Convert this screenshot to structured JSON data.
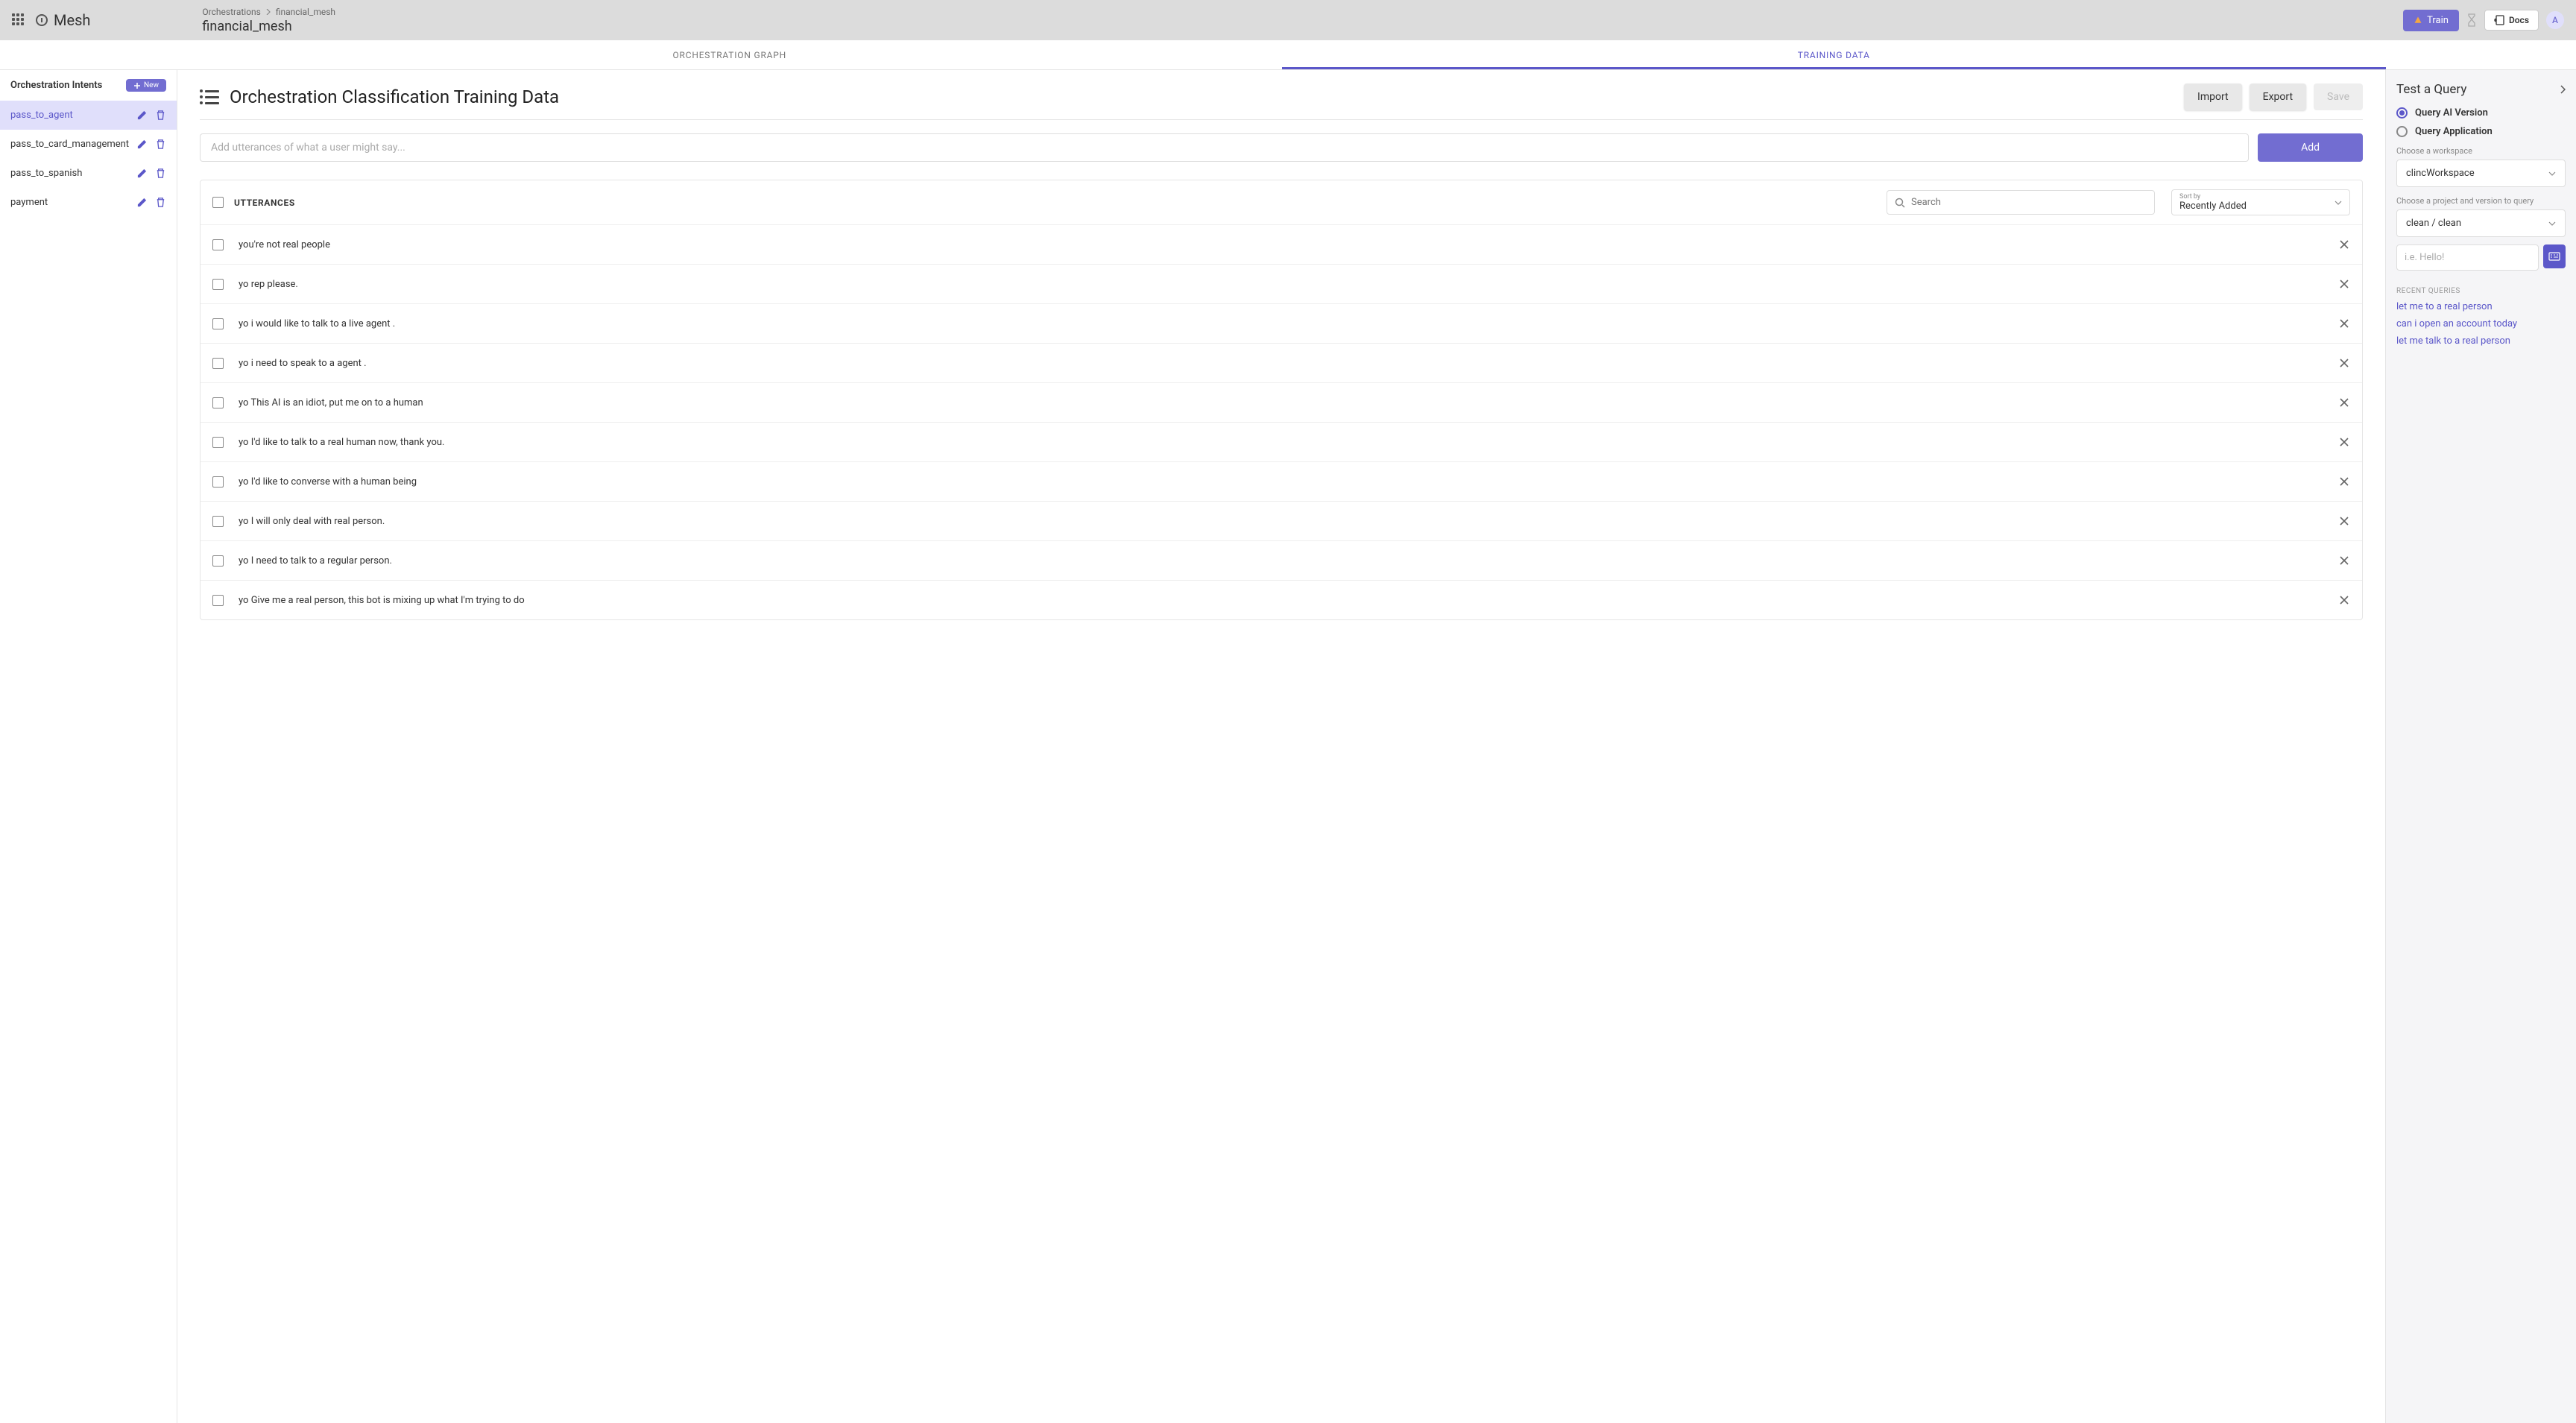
{
  "app": {
    "name": "Mesh"
  },
  "breadcrumb": {
    "root": "Orchestrations",
    "current": "financial_mesh"
  },
  "page_title": "financial_mesh",
  "topbar": {
    "train": "Train",
    "docs": "Docs",
    "avatar_initial": "A"
  },
  "tabs": {
    "graph": "ORCHESTRATION GRAPH",
    "training": "TRAINING DATA"
  },
  "sidebar": {
    "title": "Orchestration Intents",
    "new_label": "New",
    "intents": [
      {
        "name": "pass_to_agent",
        "active": true
      },
      {
        "name": "pass_to_card_management",
        "active": false
      },
      {
        "name": "pass_to_spanish",
        "active": false
      },
      {
        "name": "payment",
        "active": false
      }
    ]
  },
  "main": {
    "title": "Orchestration Classification Training Data",
    "import": "Import",
    "export": "Export",
    "save": "Save",
    "add_placeholder": "Add utterances of what a user might say...",
    "add_btn": "Add",
    "utterances_label": "UTTERANCES",
    "search_placeholder": "Search",
    "sort_label": "Sort by",
    "sort_value": "Recently Added",
    "utterances": [
      "you're not real people",
      "yo rep please.",
      "yo i would like to talk to a live agent .",
      "yo i need to speak to a agent .",
      "yo This AI is an idiot, put me on to a human",
      "yo I'd like to talk to a real human now, thank you.",
      "yo I'd like to converse with a human being",
      "yo I will only deal with real person.",
      "yo I need to talk to a regular person.",
      "yo Give me a real person, this bot is mixing up what I'm trying to do"
    ]
  },
  "rightpanel": {
    "title": "Test a Query",
    "query_ai": "Query AI Version",
    "query_app": "Query Application",
    "workspace_label": "Choose a workspace",
    "workspace_value": "clincWorkspace",
    "project_label": "Choose a project and version to query",
    "project_value": "clean / clean",
    "query_placeholder": "i.e. Hello!",
    "recent_label": "RECENT QUERIES",
    "recent": [
      "let me to a real person",
      "can i open an account today",
      "let me talk to a real person"
    ]
  }
}
